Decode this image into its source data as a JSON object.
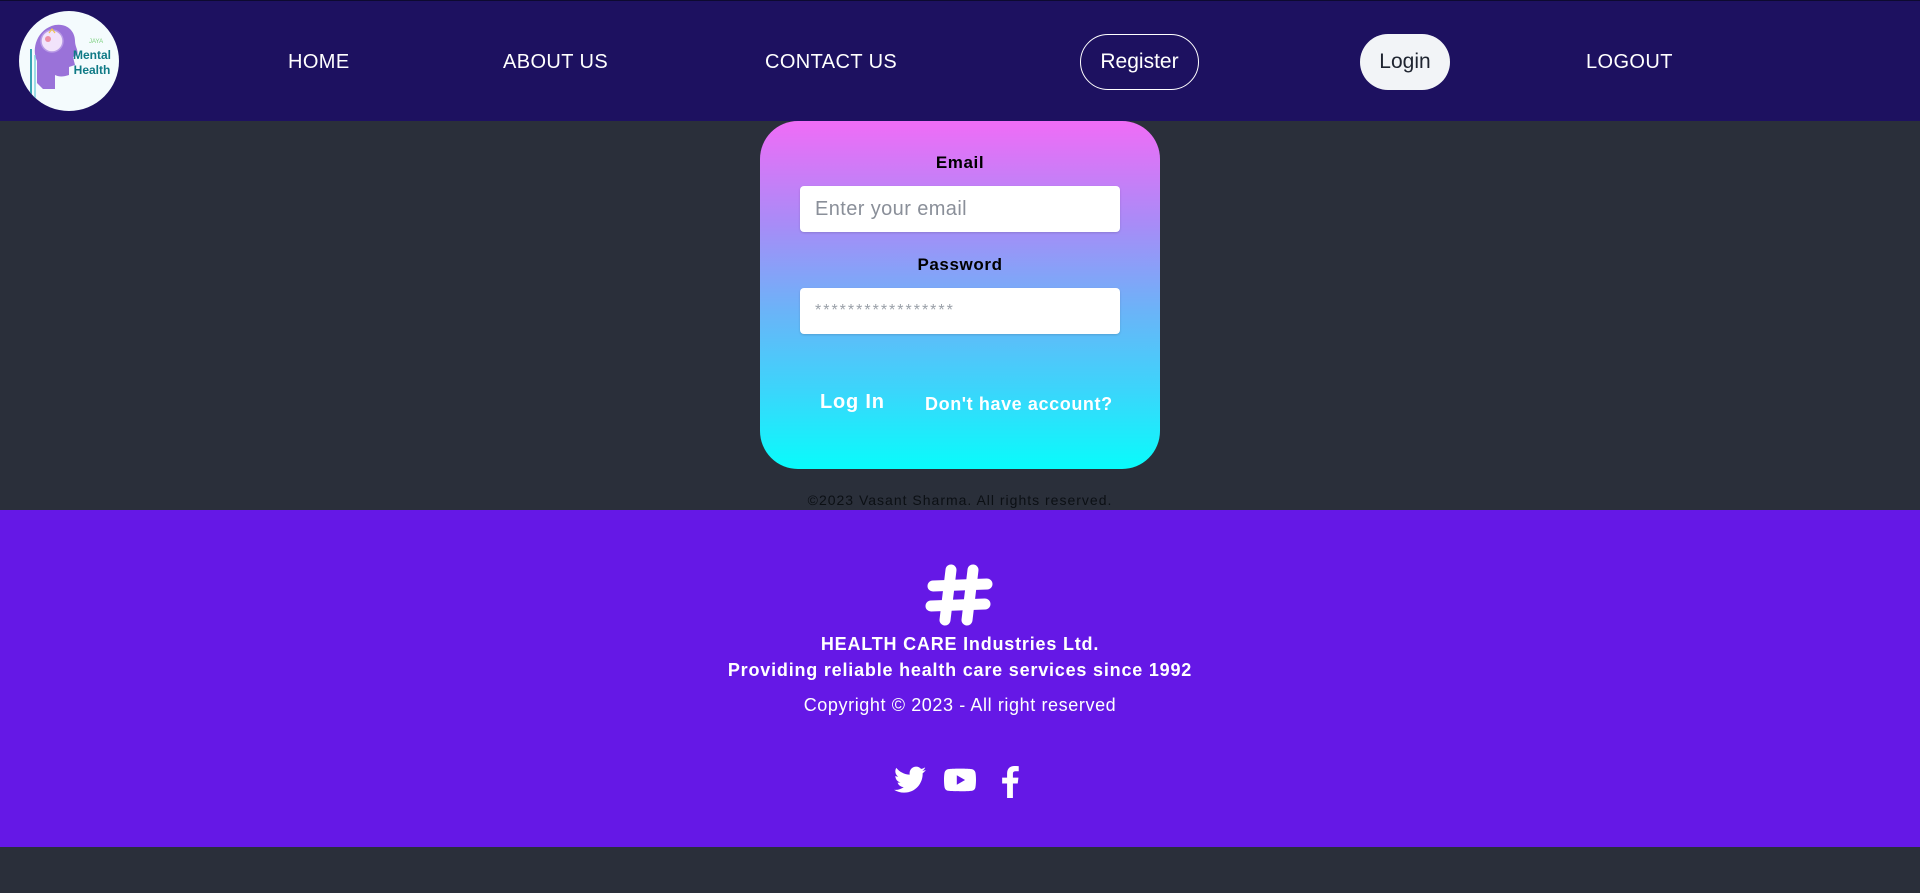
{
  "logo": {
    "small_text": "JAYA",
    "line1": "Mental",
    "line2": "Health",
    "icon": "brain-head-icon"
  },
  "nav": {
    "home": "HOME",
    "about": "ABOUT US",
    "contact": "CONTACT US",
    "register": "Register",
    "login": "Login",
    "logout": "LOGOUT"
  },
  "form": {
    "email_label": "Email",
    "email_placeholder": "Enter your email",
    "email_value": "",
    "password_label": "Password",
    "password_placeholder": "*****************",
    "password_value": "",
    "submit_label": "Log In",
    "signup_link": "Don't have account?"
  },
  "page_copyright": "©2023 Vasant Sharma. All rights reserved.",
  "footer": {
    "logo_icon": "hashtag-icon",
    "company": "HEALTH CARE Industries Ltd.",
    "tagline": "Providing reliable health care services since 1992",
    "copyright": "Copyright © 2023 - All right reserved",
    "social": [
      "twitter-icon",
      "youtube-icon",
      "facebook-icon"
    ]
  },
  "colors": {
    "navbar_bg": "#1d1160",
    "page_bg": "#2a2f3a",
    "footer_bg": "#6518e6",
    "card_gradient_top": "#f06cf7",
    "card_gradient_bottom": "#08fcfb"
  }
}
